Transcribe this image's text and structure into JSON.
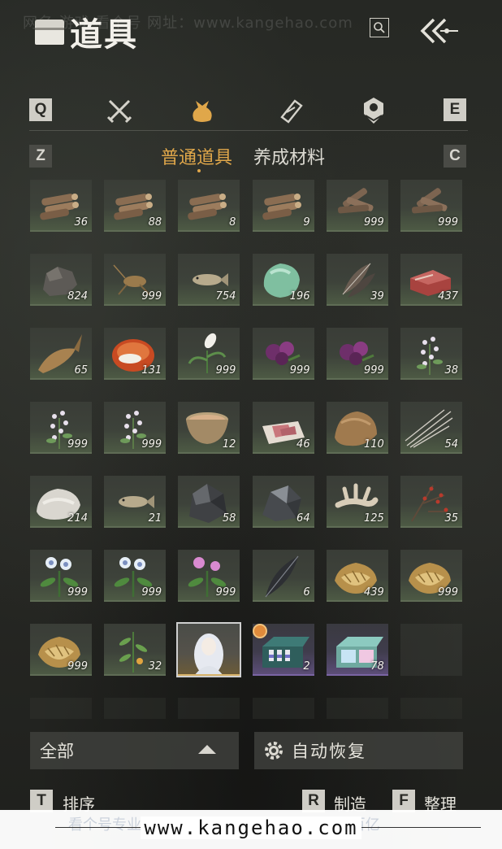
{
  "watermark": {
    "top": "网名  游戏  看个号   网址：www.kangehao.com",
    "bottom_url": "www.kangehao.com",
    "bottom_ghost": "看个号专业网易游戏账号交易平台  总成交额百亿"
  },
  "header": {
    "title": "道具"
  },
  "categories": {
    "left_key": "Q",
    "right_key": "E",
    "icons": [
      "swords-icon",
      "pouch-icon",
      "scroll-icon",
      "gem-badge-icon"
    ],
    "active_index": 1
  },
  "subtabs": {
    "left_key": "Z",
    "right_key": "C",
    "items": [
      "普通道具",
      "养成材料"
    ],
    "active_index": 0
  },
  "colors": {
    "accent": "#e0a74a",
    "rare_purple": "#7a64a3",
    "legendary_gold": "#d8b36a"
  },
  "items": [
    {
      "icon": "logs-icon",
      "qty": "36"
    },
    {
      "icon": "logs-icon",
      "qty": "88"
    },
    {
      "icon": "logs-icon",
      "qty": "8"
    },
    {
      "icon": "logs-icon",
      "qty": "9"
    },
    {
      "icon": "firewood-icon",
      "qty": "999"
    },
    {
      "icon": "firewood-icon",
      "qty": "999"
    },
    {
      "icon": "ore-rock-icon",
      "qty": "824"
    },
    {
      "icon": "cricket-icon",
      "qty": "999"
    },
    {
      "icon": "fish-icon",
      "qty": "754"
    },
    {
      "icon": "jade-stone-icon",
      "qty": "196"
    },
    {
      "icon": "feathers-icon",
      "qty": "39"
    },
    {
      "icon": "raw-meat-icon",
      "qty": "437"
    },
    {
      "icon": "carp-icon",
      "qty": "65"
    },
    {
      "icon": "red-gem-icon",
      "qty": "131"
    },
    {
      "icon": "orchid-icon",
      "qty": "999"
    },
    {
      "icon": "purple-flower-icon",
      "qty": "999"
    },
    {
      "icon": "purple-flower-icon",
      "qty": "999"
    },
    {
      "icon": "white-blossom-icon",
      "qty": "38"
    },
    {
      "icon": "white-blossom-icon",
      "qty": "999"
    },
    {
      "icon": "white-blossom-icon",
      "qty": "999"
    },
    {
      "icon": "soup-bowl-icon",
      "qty": "12"
    },
    {
      "icon": "meat-slices-icon",
      "qty": "46"
    },
    {
      "icon": "fur-pelt-icon",
      "qty": "110"
    },
    {
      "icon": "quills-icon",
      "qty": "54"
    },
    {
      "icon": "wool-icon",
      "qty": "214"
    },
    {
      "icon": "fish-icon",
      "qty": "21"
    },
    {
      "icon": "coal-ore-icon",
      "qty": "58"
    },
    {
      "icon": "iron-ore-icon",
      "qty": "64"
    },
    {
      "icon": "bone-icon",
      "qty": "125"
    },
    {
      "icon": "red-berry-branch-icon",
      "qty": "35"
    },
    {
      "icon": "blue-flower-icon",
      "qty": "999"
    },
    {
      "icon": "blue-flower-icon",
      "qty": "999"
    },
    {
      "icon": "pink-flower-icon",
      "qty": "999"
    },
    {
      "icon": "black-feather-icon",
      "qty": "6"
    },
    {
      "icon": "gold-ingot-icon",
      "qty": "439"
    },
    {
      "icon": "gold-ingot-icon",
      "qty": "999"
    },
    {
      "icon": "gold-ingot-icon",
      "qty": "999"
    },
    {
      "icon": "herb-plant-icon",
      "qty": "32"
    },
    {
      "icon": "portrait-card-icon",
      "qty": ""
    },
    {
      "icon": "gift-box-icon",
      "qty": "2"
    },
    {
      "icon": "gift-box-pastel-icon",
      "qty": "78"
    }
  ],
  "footer": {
    "filter_label": "全部",
    "auto_label": "自动恢复",
    "sort_key": "T",
    "sort_label": "排序",
    "craft_key": "R",
    "craft_label": "制造",
    "tidy_key": "F",
    "tidy_label": "整理"
  }
}
